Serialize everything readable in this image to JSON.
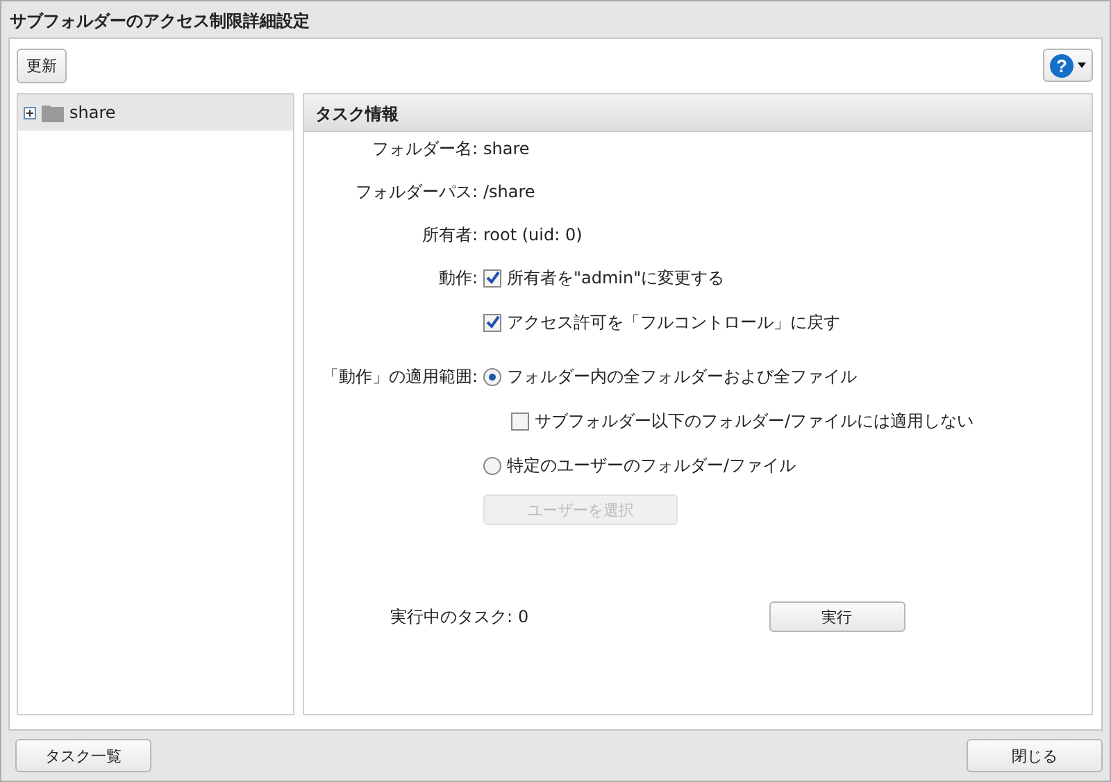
{
  "window": {
    "title": "サブフォルダーのアクセス制限詳細設定"
  },
  "toolbar": {
    "refresh_button": "更新",
    "help_button": "?"
  },
  "tree": [
    {
      "label": "share",
      "expanded": false,
      "selected": true
    }
  ],
  "panel": {
    "title": "タスク情報",
    "info": [
      {
        "label": "フォルダー名:",
        "value": "share"
      },
      {
        "label": "フォルダーパス:",
        "value": "/share"
      },
      {
        "label": "所有者:",
        "value": "root (uid: 0)"
      }
    ],
    "action_label": "動作:",
    "actions": [
      {
        "label": "所有者を\"admin\"に変更する",
        "checked": true
      },
      {
        "label": "アクセス許可を「フルコントロール」に戻す",
        "checked": true
      }
    ],
    "scope_label": "「動作」の適用範囲:",
    "scopes": [
      {
        "label": "フォルダー内の全フォルダーおよび全ファイル",
        "selected": true,
        "sub_option": {
          "label": "サブフォルダー以下のフォルダー/ファイルには適用しない",
          "checked": false
        }
      },
      {
        "label": "特定のユーザーのフォルダー/ファイル",
        "selected": false,
        "button": {
          "label": "ユーザーを選択",
          "disabled": true
        }
      }
    ],
    "running_label": "実行中のタスク:",
    "running_value": "0",
    "run_button": "実行"
  },
  "footer": {
    "task_list_button": "タスク一覧",
    "close_button": "閉じる"
  }
}
